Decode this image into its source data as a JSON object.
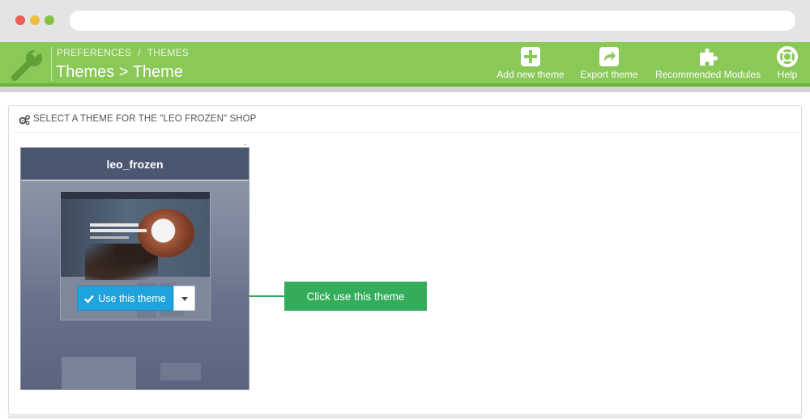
{
  "header": {
    "breadcrumb": [
      "PREFERENCES",
      "THEMES"
    ],
    "breadcrumb_separator": "/",
    "title": "Themes > Theme",
    "toolbar": [
      {
        "label": "Add new theme",
        "icon": "plus-square-icon"
      },
      {
        "label": "Export theme",
        "icon": "share-square-icon"
      },
      {
        "label": "Recommended Modules",
        "icon": "puzzle-piece-icon"
      },
      {
        "label": "Help",
        "icon": "life-ring-icon"
      }
    ],
    "colors": {
      "bar": "#8ac858",
      "accent": "#6ab33a"
    }
  },
  "panel": {
    "heading": "SELECT A THEME FOR THE \"LEO FROZEN\" SHOP",
    "heading_icon": "cogs-icon"
  },
  "theme_card": {
    "name": "leo_frozen",
    "use_button_label": "Use this theme",
    "use_button_color": "#1ea3de"
  },
  "callout": {
    "text": "Click use this theme",
    "color": "#34ad5b"
  }
}
